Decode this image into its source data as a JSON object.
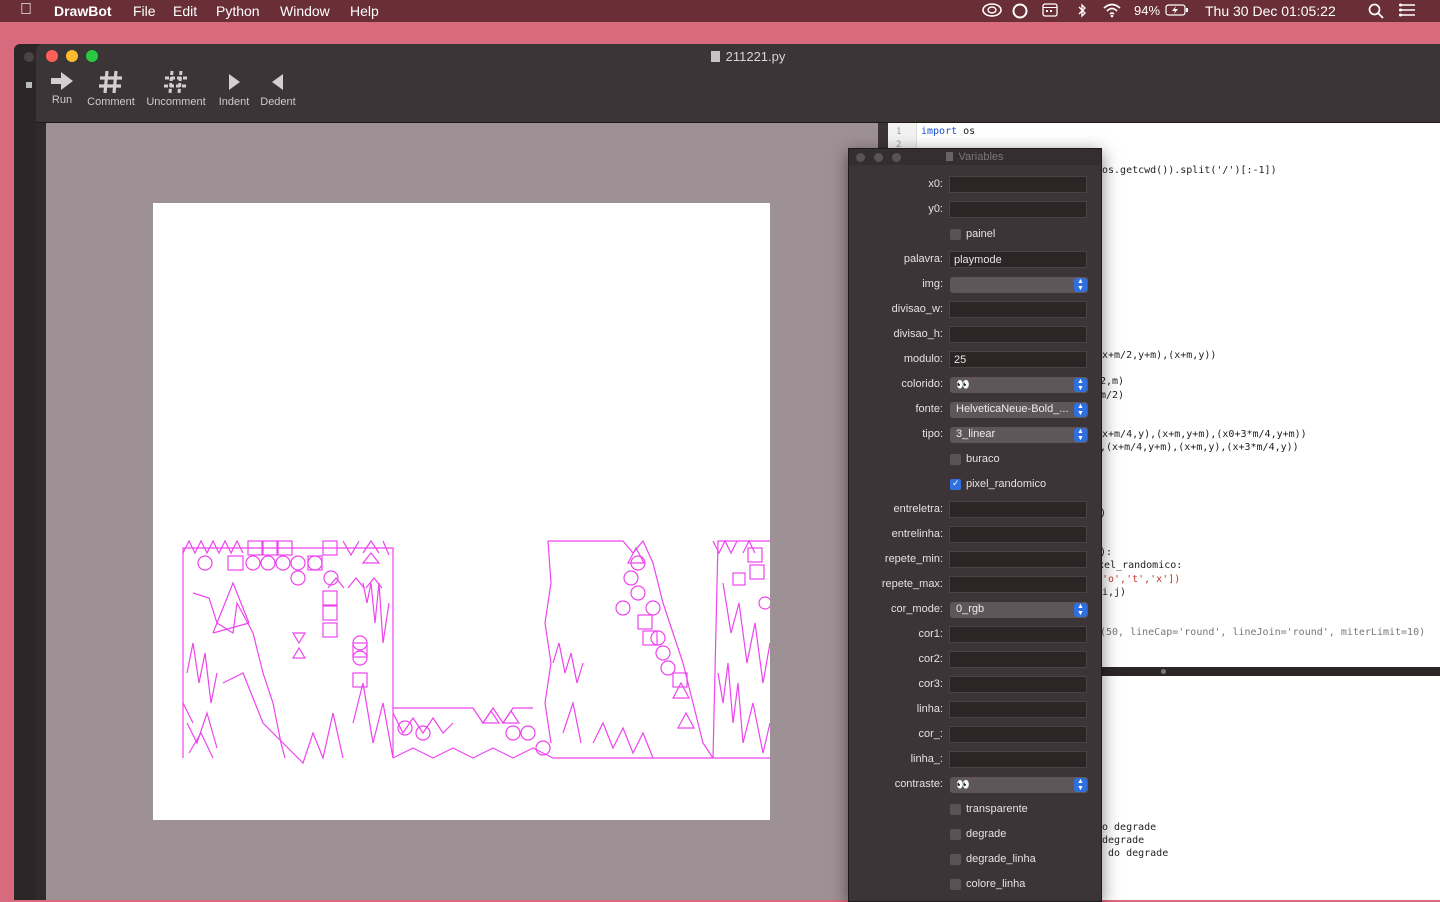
{
  "menubar": {
    "app": "DrawBot",
    "items": [
      "File",
      "Edit",
      "Python",
      "Window",
      "Help"
    ],
    "battery": "94%",
    "datetime": "Thu 30 Dec  01:05:22"
  },
  "window": {
    "title": "211221.py"
  },
  "toolbar": {
    "run": "Run",
    "comment": "Comment",
    "uncomment": "Uncomment",
    "indent": "Indent",
    "dedent": "Dedent"
  },
  "editor": {
    "line_numbers": [
      "1",
      "2"
    ],
    "line1_kw": "import",
    "line1_rest": " os",
    "frag1": "os.getcwd()).split('/')[:-1])",
    "frag2": "x+m/2,y+m),(x+m,y))",
    "frag3": "2,m)",
    "frag4": "m/2)",
    "frag5": "x+m/4,y),(x+m,y+m),(x0+3*m/4,y+m))",
    "frag6": ",(x+m/4,y+m),(x+m,y),(x+3*m/4,y))",
    "frag7": ")",
    "frag8": "):",
    "frag9": "xel_randomico:",
    "frag10": "'o','t','x'])",
    "frag11": "i,j)",
    "frag12": "(50, lineCap='round', lineJoin='round', miterLimit=10)"
  },
  "output": {
    "lines": [
      "o degrade",
      "degrade",
      " do degrade"
    ]
  },
  "variables": {
    "title": "Variables",
    "x0": {
      "label": "x0:",
      "value": ""
    },
    "y0": {
      "label": "y0:",
      "value": ""
    },
    "painel": {
      "label": "painel",
      "checked": false
    },
    "palavra": {
      "label": "palavra:",
      "value": "playmode"
    },
    "img": {
      "label": "img:",
      "value": ""
    },
    "divisao_w": {
      "label": "divisao_w:",
      "value": ""
    },
    "divisao_h": {
      "label": "divisao_h:",
      "value": ""
    },
    "modulo": {
      "label": "modulo:",
      "value": "25"
    },
    "colorido": {
      "label": "colorido:",
      "value": "👀"
    },
    "fonte": {
      "label": "fonte:",
      "value": "HelveticaNeue-Bold_..."
    },
    "tipo": {
      "label": "tipo:",
      "value": "3_linear"
    },
    "buraco": {
      "label": "buraco",
      "checked": false
    },
    "pixel_randomico": {
      "label": "pixel_randomico",
      "checked": true
    },
    "entreletra": {
      "label": "entreletra:",
      "value": ""
    },
    "entrelinha": {
      "label": "entrelinha:",
      "value": ""
    },
    "repete_min": {
      "label": "repete_min:",
      "value": ""
    },
    "repete_max": {
      "label": "repete_max:",
      "value": ""
    },
    "cor_mode": {
      "label": "cor_mode:",
      "value": "0_rgb"
    },
    "cor1": {
      "label": "cor1:",
      "value": ""
    },
    "cor2": {
      "label": "cor2:",
      "value": ""
    },
    "cor3": {
      "label": "cor3:",
      "value": ""
    },
    "linha": {
      "label": "linha:",
      "value": ""
    },
    "cor_": {
      "label": "cor_:",
      "value": ""
    },
    "linha_": {
      "label": "linha_:",
      "value": ""
    },
    "contraste": {
      "label": "contraste:",
      "value": "👀"
    },
    "transparente": {
      "label": "transparente",
      "checked": false
    },
    "degrade": {
      "label": "degrade",
      "checked": false
    },
    "degrade_linha": {
      "label": "degrade_linha",
      "checked": false
    },
    "colore_linha": {
      "label": "colore_linha",
      "checked": false
    }
  },
  "colors": {
    "desktop": "#d86a7d",
    "menubar": "#6a2e36",
    "drawing_stroke": "#ee44ee",
    "canvas_bg": "#9e9195"
  }
}
